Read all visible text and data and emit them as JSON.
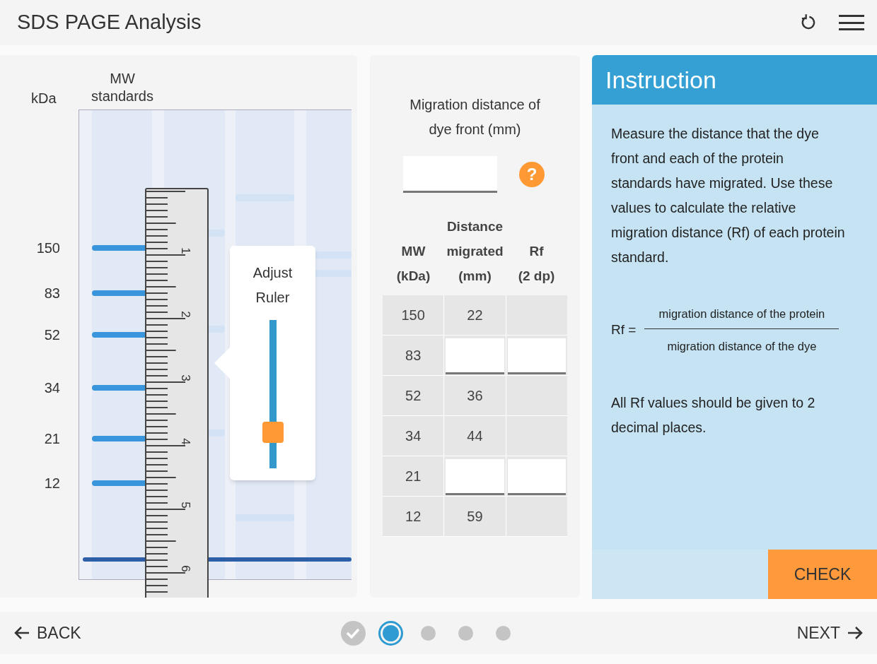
{
  "header": {
    "title": "SDS PAGE Analysis"
  },
  "gel": {
    "kda_heading": "kDa",
    "lane_heading": "MW\nstandards",
    "markers": [
      {
        "kda": "150"
      },
      {
        "kda": "83"
      },
      {
        "kda": "52"
      },
      {
        "kda": "34"
      },
      {
        "kda": "21"
      },
      {
        "kda": "12"
      }
    ],
    "ruler_labels": [
      "1",
      "2",
      "3",
      "4",
      "5",
      "6"
    ],
    "adjust": {
      "label": "Adjust\nRuler",
      "level": 0.2
    }
  },
  "dye_front": {
    "label": "Migration distance of\ndye front (mm)",
    "help": "?"
  },
  "table": {
    "columns": [
      "MW\n(kDa)",
      "Distance\nmigrated\n(mm)",
      "Rf\n(2 dp)"
    ],
    "rows": [
      {
        "kind": "given",
        "mw": "150",
        "distance": "22"
      },
      {
        "kind": "input",
        "mw": "83"
      },
      {
        "kind": "given",
        "mw": "52",
        "distance": "36"
      },
      {
        "kind": "given",
        "mw": "34",
        "distance": "44"
      },
      {
        "kind": "input",
        "mw": "21"
      },
      {
        "kind": "given",
        "mw": "12",
        "distance": "59"
      }
    ]
  },
  "instruction": {
    "title": "Instruction",
    "text": "Measure the distance that the dye front and each of the protein standards have migrated. Use these values to calculate the relative migration distance (Rf) of each protein standard.",
    "formula": {
      "lhs": "Rf =",
      "numerator": "migration distance of the protein",
      "denominator": "migration distance of the dye"
    },
    "note": "All Rf values should be given to 2 decimal places.",
    "check": "CHECK"
  },
  "footer": {
    "back": "BACK",
    "next": "NEXT",
    "steps": [
      {
        "completed": true,
        "selected": false
      },
      {
        "completed": false,
        "selected": true
      },
      {
        "completed": false,
        "selected": false
      },
      {
        "completed": false,
        "selected": false
      },
      {
        "completed": false,
        "selected": false
      }
    ]
  }
}
